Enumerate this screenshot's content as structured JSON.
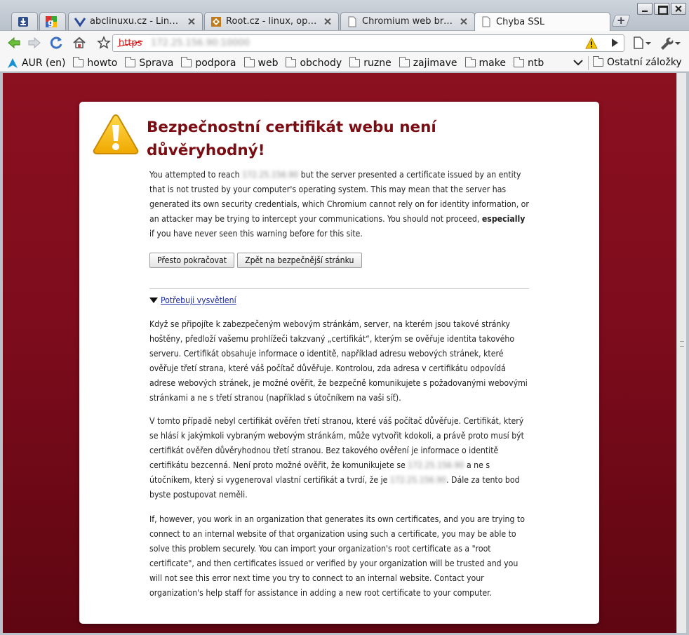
{
  "tabs": [
    {
      "title": "",
      "favicon": "download-icon"
    },
    {
      "title": "",
      "favicon": "google-icon"
    },
    {
      "title": "abclinuxu.cz - Linux n...",
      "favicon": "abclinuxu-icon"
    },
    {
      "title": "Root.cz - linux, open ...",
      "favicon": "root-icon"
    },
    {
      "title": "Chromium web brow...",
      "favicon": "page-icon"
    },
    {
      "title": "Chyba SSL",
      "favicon": "page-icon",
      "active": true
    }
  ],
  "omnibox": {
    "scheme": "https",
    "host": "172.25.156.90:10000"
  },
  "bookmarks": {
    "items": [
      {
        "label": "AUR (en)",
        "icon": "arch-icon"
      },
      {
        "label": "howto",
        "icon": "folder-icon"
      },
      {
        "label": "Sprava",
        "icon": "folder-icon"
      },
      {
        "label": "podpora",
        "icon": "folder-icon"
      },
      {
        "label": "web",
        "icon": "folder-icon"
      },
      {
        "label": "obchody",
        "icon": "folder-icon"
      },
      {
        "label": "ruzne",
        "icon": "folder-icon"
      },
      {
        "label": "zajimave",
        "icon": "folder-icon"
      },
      {
        "label": "make",
        "icon": "folder-icon"
      },
      {
        "label": "ntb",
        "icon": "folder-icon"
      }
    ],
    "other": "Ostatní záložky"
  },
  "page": {
    "heading": "Bezpečnostní certifikát webu není důvěryhodný!",
    "intro": {
      "p1": "You attempted to reach",
      "host": "172.25.156.90",
      "p2": " but the server presented a certificate issued by an entity that is not trusted by your computer's operating system. This may mean that the server has generated its own security credentials, which Chromium cannot rely on for identity information, or an attacker may be trying to intercept your communications. You should not proceed, ",
      "strong": "especially",
      "p3": " if you have never seen this warning before for this site."
    },
    "proceed_button": "Přesto pokračovat",
    "back_button": "Zpět na bezpečnější stránku",
    "more_link": "Potřebuji vysvětlení",
    "explanation1": "Když se připojíte k zabezpečeným webovým stránkám, server, na kterém jsou takové stránky hoštěny, předloží vašemu prohlížeči takzvaný „certifikát“, kterým se ověřuje identita takového serveru. Certifikát obsahuje informace o identitě, například adresu webových stránek, které ověřuje třetí strana, které váš počítač důvěřuje. Kontrolou, zda adresa v certifikátu odpovídá adrese webových stránek, je možné ověřit, že bezpečně komunikujete s požadovanými webovými stránkami a ne s třetí stranou (například s útočníkem na vaši síť).",
    "explanation2": {
      "p1": "V tomto případě nebyl certifikát ověřen třetí stranou, které váš počítač důvěřuje. Certifikát, který se hlásí k jakýmkoli vybraným webovým stránkám, může vytvořit kdokoli, a právě proto musí být certifikát ověřen důvěryhodnou třetí stranou. Bez takového ověření je informace o identitě certifikátu bezcenná. Není proto možné ověřit, že komunikujete se ",
      "host1": "172.25.156.90",
      "p2": " a ne s útočníkem, který si vygeneroval vlastní certifikát a tvrdí, že je ",
      "host2": "172.25.156.90",
      "p3": ". Dále za tento bod byste postupovat neměli."
    },
    "explanation3": "If, however, you work in an organization that generates its own certificates, and you are trying to connect to an internal website of that organization using such a certificate, you may be able to solve this problem securely. You can import your organization's root certificate as a \"root certificate\", and then certificates issued or verified by your organization will be trusted and you will not see this error next time you try to connect to an internal website. Contact your organization's help staff for assistance in adding a new root certificate to your computer."
  },
  "colors": {
    "page_background": "#7d0c1c",
    "heading": "#7a0c12",
    "link": "#1c2ca5",
    "warning_icon": "#f5c400"
  }
}
